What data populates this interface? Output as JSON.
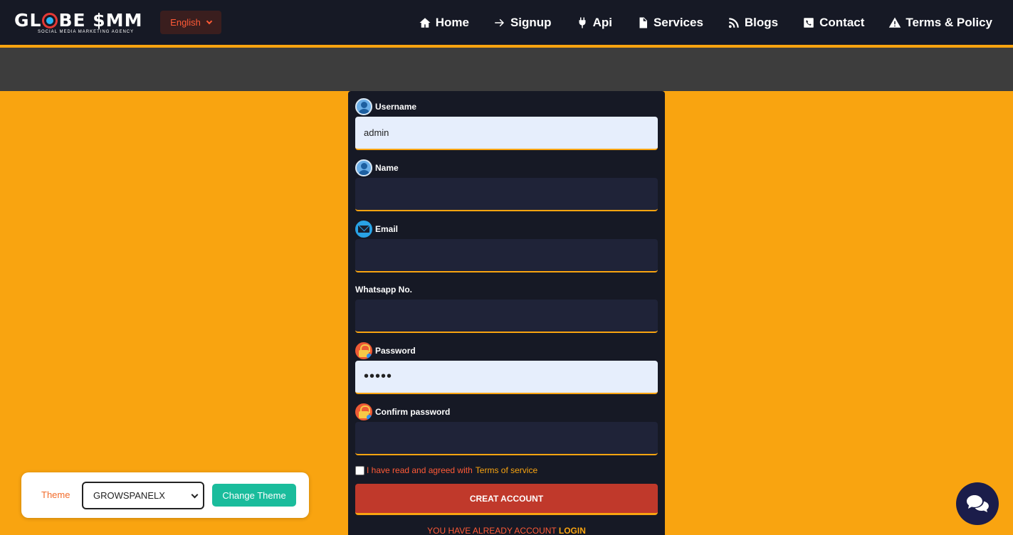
{
  "header": {
    "logo_text": "GL BE $MM",
    "logo_subtitle": "SOCIAL MEDIA MARKETING AGENCY",
    "language": "English",
    "nav": [
      {
        "label": "Home",
        "icon": "home-icon"
      },
      {
        "label": "Signup",
        "icon": "arrow-right-icon"
      },
      {
        "label": "Api",
        "icon": "plug-icon"
      },
      {
        "label": "Services",
        "icon": "document-icon"
      },
      {
        "label": "Blogs",
        "icon": "rss-icon"
      },
      {
        "label": "Contact",
        "icon": "phone-icon"
      },
      {
        "label": "Terms & Policy",
        "icon": "warning-icon"
      }
    ]
  },
  "form": {
    "username": {
      "label": "Username",
      "value": "admin"
    },
    "name": {
      "label": "Name",
      "value": ""
    },
    "email": {
      "label": "Email",
      "value": ""
    },
    "whatsapp": {
      "label": "Whatsapp No.",
      "value": ""
    },
    "password": {
      "label": "Password",
      "value": "•••••"
    },
    "confirm_password": {
      "label": "Confirm password",
      "value": ""
    },
    "terms_text": "I have read and agreed with",
    "terms_link": "Terms of service",
    "submit_label": "CREAT ACCOUNT",
    "already_text": "YOU HAVE ALREADY ACCOUNT",
    "login_link": "LOGIN"
  },
  "theme_widget": {
    "label": "Theme",
    "selected": "GROWSPANELX",
    "button_label": "Change Theme"
  },
  "colors": {
    "accent": "#f9a410",
    "header_bg": "#161925",
    "submit": "#c0392b",
    "theme_button": "#1abc9c"
  }
}
